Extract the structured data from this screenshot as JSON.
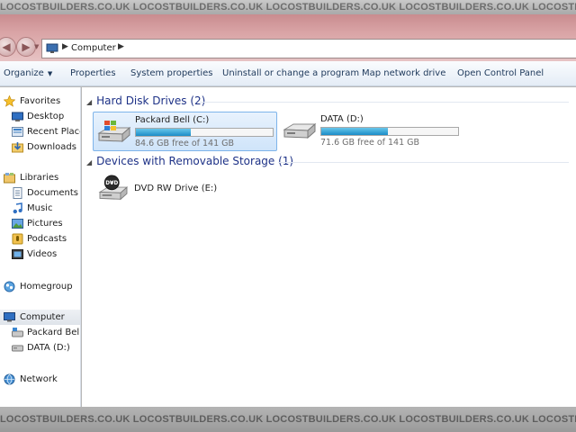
{
  "watermark": {
    "text": "LOCOSTBUILDERS.CO.UK"
  },
  "address_bar": {
    "path_segment": "Computer"
  },
  "toolbar": {
    "organize_label": "Organize",
    "properties_label": "Properties",
    "system_properties_label": "System properties",
    "uninstall_label": "Uninstall or change a program",
    "map_drive_label": "Map network drive",
    "control_panel_label": "Open Control Panel"
  },
  "navpane": {
    "favorites": {
      "label": "Favorites",
      "items": [
        {
          "label": "Desktop"
        },
        {
          "label": "Recent Places"
        },
        {
          "label": "Downloads"
        }
      ]
    },
    "libraries": {
      "label": "Libraries",
      "items": [
        {
          "label": "Documents"
        },
        {
          "label": "Music"
        },
        {
          "label": "Pictures"
        },
        {
          "label": "Podcasts"
        },
        {
          "label": "Videos"
        }
      ]
    },
    "homegroup": {
      "label": "Homegroup"
    },
    "computer": {
      "label": "Computer",
      "items": [
        {
          "label": "Packard Bell (C:)"
        },
        {
          "label": "DATA (D:)"
        }
      ]
    },
    "network": {
      "label": "Network"
    }
  },
  "content": {
    "hdd_group": {
      "title": "Hard Disk Drives (2)"
    },
    "drives": [
      {
        "name": "Packard Bell (C:)",
        "free_text": "84.6 GB free of 141 GB",
        "used_fraction": 0.4
      },
      {
        "name": "DATA (D:)",
        "free_text": "71.6 GB free of 141 GB",
        "used_fraction": 0.49
      }
    ],
    "removable_group": {
      "title": "Devices with Removable Storage (1)"
    },
    "removable": [
      {
        "name": "DVD RW Drive (E:)",
        "icon_text": "DVD"
      }
    ]
  },
  "colors": {
    "command_text": "#1e395b",
    "group_header": "#1e3287",
    "usage_bar": "#1b8cc7",
    "selection_border": "#7eb4ea"
  }
}
